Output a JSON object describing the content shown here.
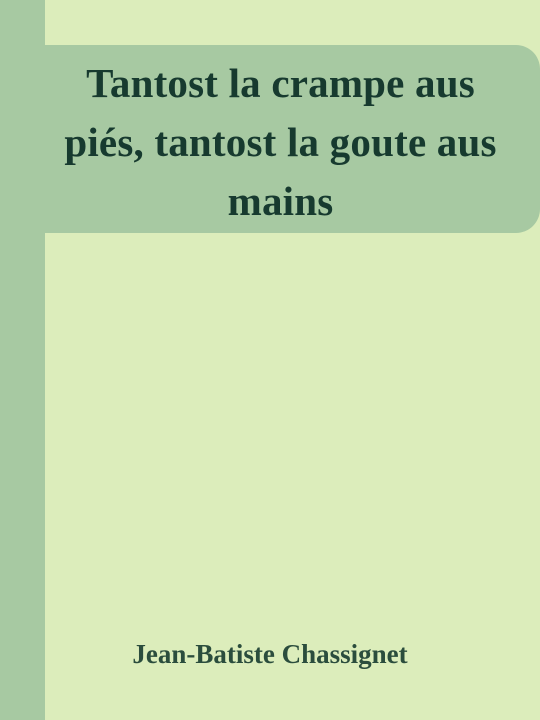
{
  "cover": {
    "title": "Tantost la crampe aus piés, tantost la goute aus mains",
    "author": "Jean-Batiste Chassignet",
    "colors": {
      "background": "#dcedbb",
      "band": "#a7c9a2",
      "title_text": "#173a2f",
      "author_text": "#2b4d3d"
    }
  }
}
